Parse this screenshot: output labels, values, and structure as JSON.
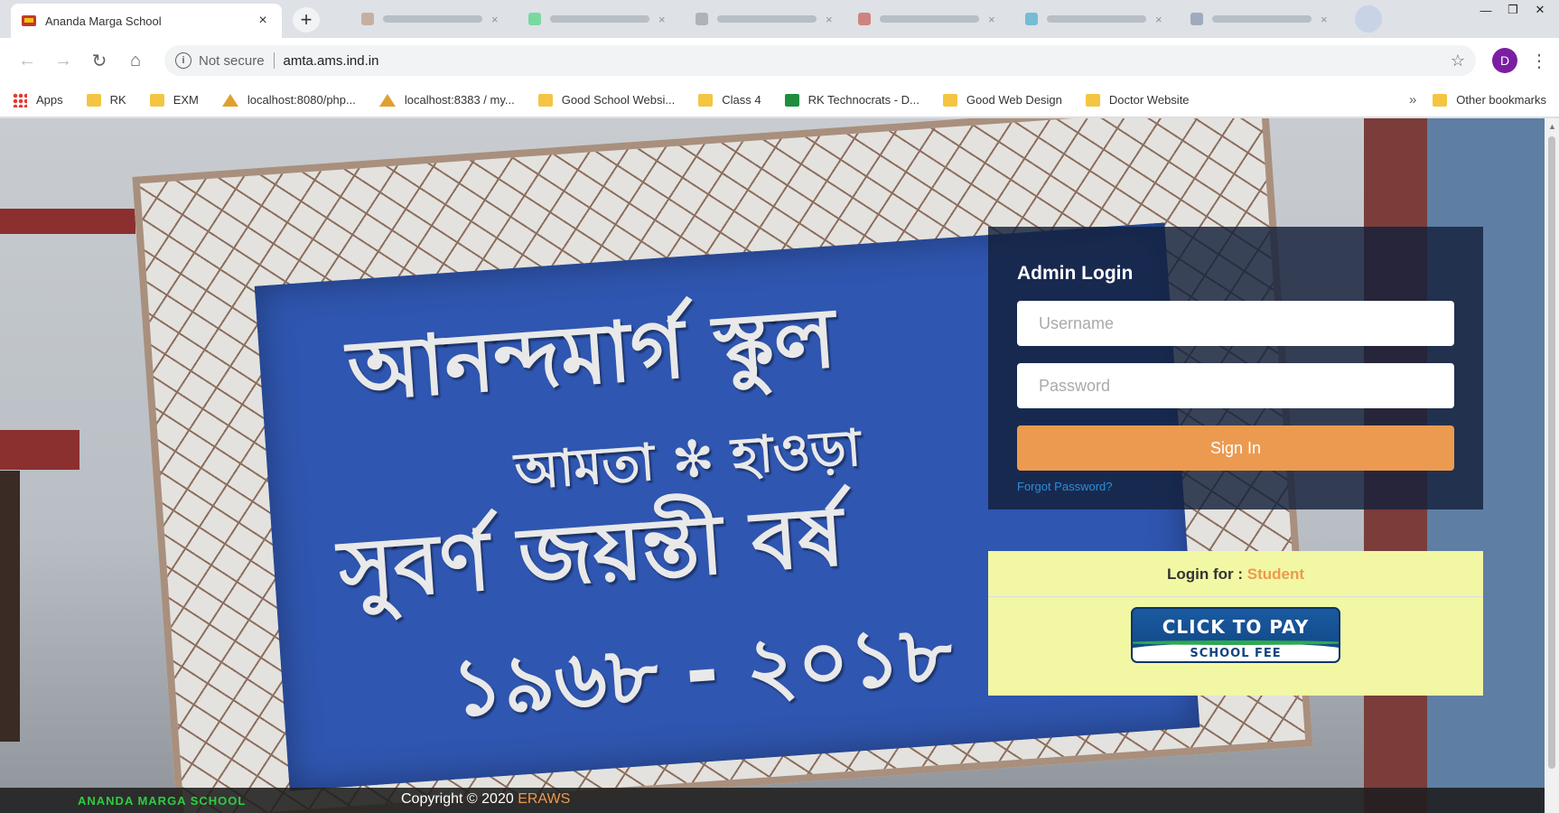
{
  "browser": {
    "active_tab_title": "Ananda Marga School",
    "tab_close_symbol": "×",
    "new_tab_symbol": "+",
    "window_controls": [
      "—",
      "❐",
      "✕"
    ],
    "nav": {
      "back": "←",
      "forward": "→",
      "reload": "↻",
      "home": "⌂"
    },
    "address": {
      "security_label": "Not secure",
      "url": "amta.ams.ind.in",
      "info_symbol": "i"
    },
    "star_symbol": "☆",
    "profile_initial": "D",
    "menu_symbol": "⋮",
    "bookmarks": [
      "Apps",
      "RK",
      "EXM",
      "localhost:8080/php...",
      "localhost:8383 / my...",
      "Good School Websi...",
      "Class 4",
      "RK Technocrats - D...",
      "Good Web Design",
      "Doctor Website"
    ],
    "bookmarks_overflow": "»",
    "other_bookmarks": "Other bookmarks"
  },
  "page": {
    "sign": {
      "line1": "আনন্দমার্গ স্কুল",
      "line2": "আমতা ✻ হাওড়া",
      "line3": "সুবর্ণ জয়ন্তী বর্ষ",
      "line4": "১৯৬৮ - ২০১৮"
    },
    "login": {
      "title": "Admin Login",
      "username_placeholder": "Username",
      "password_placeholder": "Password",
      "signin_label": "Sign In",
      "forgot_label": "Forgot Password?"
    },
    "pay": {
      "login_for_label": "Login for :",
      "role": "Student",
      "button_line1": "CLICK TO PAY",
      "button_line2": "SCHOOL FEE"
    },
    "footer": {
      "brand": "ANANDA MARGA SCHOOL",
      "copyright": "Copyright © 2020",
      "company": "ERAWS"
    }
  },
  "colors": {
    "accent_orange": "#ec9a4f",
    "panel_dark": "#14203a",
    "pay_panel": "#f2f7a4",
    "sign_blue": "#2f56b0",
    "footer_brand": "#2ecc40",
    "profile": "#7b1fa2"
  },
  "icons": {
    "back": "arrow-left-icon",
    "forward": "arrow-right-icon",
    "reload": "reload-icon",
    "home": "home-icon",
    "info": "info-icon",
    "star": "star-icon",
    "menu": "kebab-menu-icon",
    "folder": "folder-icon",
    "apps": "apps-grid-icon"
  }
}
